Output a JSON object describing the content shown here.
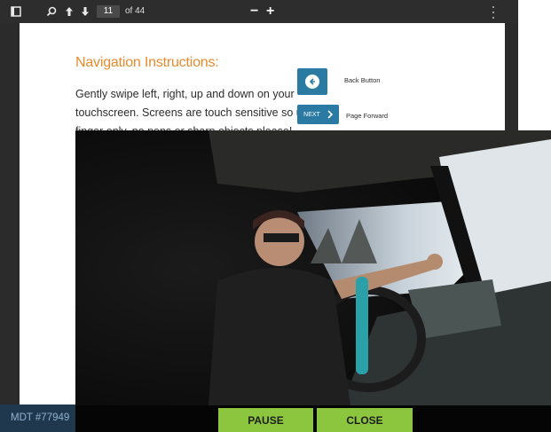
{
  "toolbar": {
    "sidebar_toggle": "sidebar-toggle-icon",
    "search": "search-icon",
    "prev_page": "arrow-up-icon",
    "next_page": "arrow-down-icon",
    "current_page": "11",
    "page_total": "of 44",
    "zoom_out": "−",
    "zoom_in": "+",
    "more": "more-vert-icon"
  },
  "document": {
    "title": "Navigation Instructions:",
    "body_lines": [
      "Gently swipe left, right, up and down on your",
      "touchscreen. Screens are touch sensitive so use your",
      "finger only, no pens or sharp objects please!"
    ],
    "back_button_label": "Back Button",
    "next_button_text": "NEXT",
    "page_forward_label": "Page Forward",
    "accent_color": "#e88a2e",
    "button_color": "#2a7aa3"
  },
  "device": {
    "id": "MDT #77949"
  },
  "video_controls": {
    "pause": "PAUSE",
    "close": "CLOSE",
    "button_color": "#8cc63e"
  }
}
